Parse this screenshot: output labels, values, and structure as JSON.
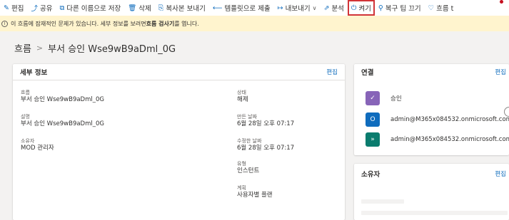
{
  "toolbar": {
    "items": [
      {
        "icon": "✎",
        "label": "편집"
      },
      {
        "icon": "⤴",
        "label": "공유"
      },
      {
        "icon": "⧉",
        "label": "다른 이름으로 저장"
      },
      {
        "icon": "🗑",
        "label": "삭제"
      },
      {
        "icon": "⎘",
        "label": "복사본 보내기"
      },
      {
        "icon": "⟵",
        "label": "템플릿으로 제출"
      },
      {
        "icon": "↦",
        "label": "내보내기"
      },
      {
        "icon": "⇗",
        "label": "분석"
      },
      {
        "icon": "⏻",
        "label": "켜기"
      },
      {
        "icon": "⚲",
        "label": "복구 팁 끄기"
      },
      {
        "icon": "♡",
        "label": "흐름 t"
      }
    ]
  },
  "banner": {
    "text_prefix": "이 흐름에 잠재적인 문제가 있습니다. 세부 정보를 보려면 ",
    "text_bold": "흐름 검사기",
    "text_suffix": "를 엽니다."
  },
  "breadcrumb": {
    "root": "흐름",
    "sep": ">",
    "current": "부서 승인 Wse9wB9aDml_0G"
  },
  "details": {
    "title": "세부 정보",
    "edit": "편집",
    "fields": {
      "flow": {
        "label": "흐름",
        "value": "부서 승인 Wse9wB9aDml_0G"
      },
      "desc": {
        "label": "설명",
        "value": "부서 승인 Wse9wB9aDml_0G"
      },
      "owner": {
        "label": "소유자",
        "value": "MOD 관리자"
      },
      "status": {
        "label": "상태",
        "value": "해제"
      },
      "created": {
        "label": "만든 날짜",
        "value": "6월 28일 오후 07:17"
      },
      "modified": {
        "label": "수정한 날짜",
        "value": "6월 28일 오후 07:17"
      },
      "type": {
        "label": "유형",
        "value": "인스턴트"
      },
      "plan": {
        "label": "계획",
        "value": "사용자별 플랜"
      }
    }
  },
  "connections": {
    "title": "연결",
    "edit": "편집",
    "items": [
      {
        "label": "승인",
        "color": "#8764b8",
        "icon": "✓"
      },
      {
        "label": "admin@M365x084532.onmicrosoft.com",
        "color": "#0f6cbd",
        "icon": "O"
      },
      {
        "label": "admin@M365x084532.onmicrosoft.com",
        "color": "#0a7c6e",
        "icon": "»"
      }
    ]
  },
  "owners": {
    "title": "소유자",
    "edit": "편집"
  }
}
